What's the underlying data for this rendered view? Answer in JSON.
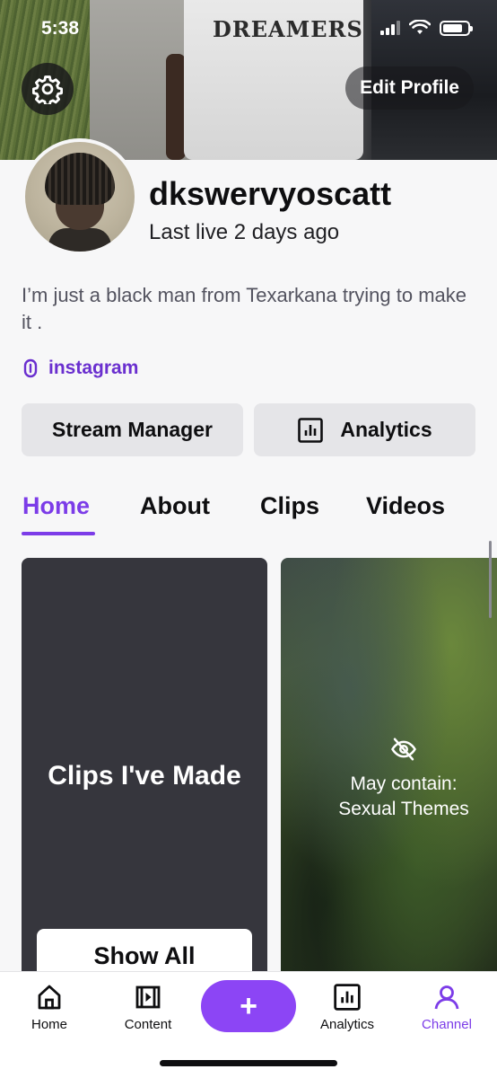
{
  "status_bar": {
    "time": "5:38"
  },
  "banner": {
    "shirt_text": "DREAMERS",
    "edit_profile_label": "Edit Profile"
  },
  "profile": {
    "username": "dkswervyoscatt",
    "last_live": "Last live 2 days ago",
    "bio": "I’m just a black man from Texarkana trying to make it .",
    "link_label": "instagram"
  },
  "actions": {
    "stream_manager": "Stream Manager",
    "analytics": "Analytics"
  },
  "tabs": [
    {
      "label": "Home",
      "active": true
    },
    {
      "label": "About",
      "active": false
    },
    {
      "label": "Clips",
      "active": false
    },
    {
      "label": "Videos",
      "active": false
    }
  ],
  "cards": {
    "clips": {
      "title": "Clips I've Made",
      "button": "Show All"
    },
    "video": {
      "warning_line1": "May contain:",
      "warning_line2": "Sexual Themes"
    }
  },
  "bottom_nav": {
    "home": "Home",
    "content": "Content",
    "create": "+",
    "analytics": "Analytics",
    "channel": "Channel"
  },
  "colors": {
    "accent": "#7c3ce8",
    "create_button": "#8c45f5",
    "card_dark": "#36363d"
  }
}
